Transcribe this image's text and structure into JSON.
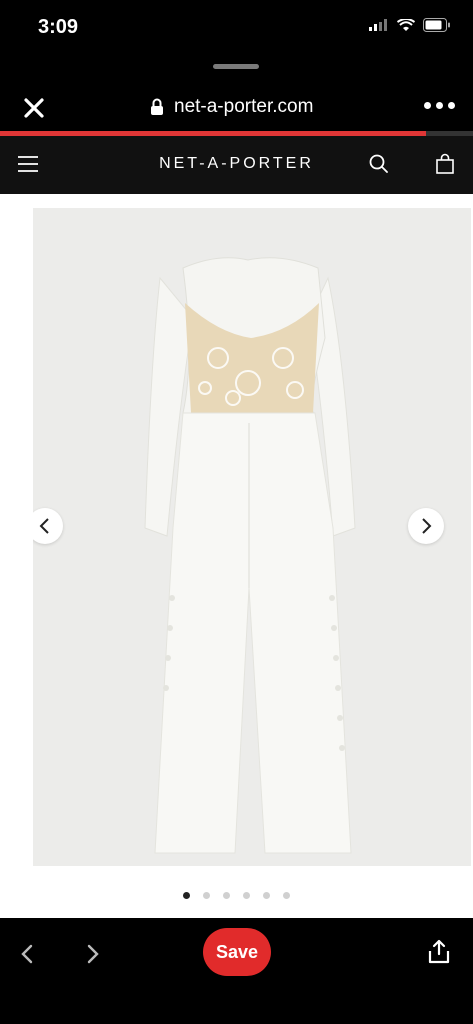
{
  "status_bar": {
    "time": "3:09"
  },
  "browser": {
    "url": "net-a-porter.com",
    "load_progress_percent": 90
  },
  "site_header": {
    "brand": "NET-A-PORTER"
  },
  "gallery": {
    "image_count": 6,
    "active_index": 0
  },
  "toolbar": {
    "save_label": "Save"
  },
  "colors": {
    "accent": "#e12b2b",
    "header_bg": "#111111",
    "gallery_bg": "#ececea"
  }
}
